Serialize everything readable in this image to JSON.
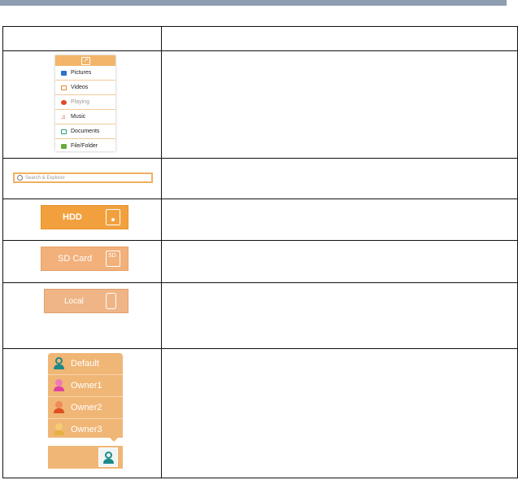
{
  "table": {
    "header": {
      "col1": "",
      "col2": ""
    },
    "rows": [
      {
        "description": ""
      },
      {
        "description": ""
      },
      {
        "description": ""
      },
      {
        "description": ""
      },
      {
        "description": ""
      },
      {
        "description": ""
      }
    ]
  },
  "menu": {
    "items": [
      {
        "label": "Pictures",
        "icon": "pictures-icon",
        "color": "#2f6fd0"
      },
      {
        "label": "Videos",
        "icon": "videos-icon",
        "color": "#e08a2a"
      },
      {
        "label": "Playing",
        "icon": "playing-icon",
        "color": "#e04a2a"
      },
      {
        "label": "Music",
        "icon": "music-icon",
        "color": "#e04a2a"
      },
      {
        "label": "Documents",
        "icon": "documents-icon",
        "color": "#2aa07a"
      },
      {
        "label": "File/Folder",
        "icon": "folder-icon",
        "color": "#6aaa3a"
      }
    ]
  },
  "search": {
    "placeholder": "Search & Explorer"
  },
  "buttons": {
    "hdd": "HDD",
    "sd": "SD Card",
    "sd_icon_text": "SD",
    "local": "Local"
  },
  "profiles": {
    "items": [
      {
        "label": "Default",
        "color": "#1a8a8a"
      },
      {
        "label": "Owner1",
        "color": "#e040a0"
      },
      {
        "label": "Owner2",
        "color": "#e05020"
      },
      {
        "label": "Owner3",
        "color": "#e8b040"
      }
    ]
  },
  "colors": {
    "accent_orange": "#f2a03e",
    "header_bar": "#8f9db1"
  }
}
